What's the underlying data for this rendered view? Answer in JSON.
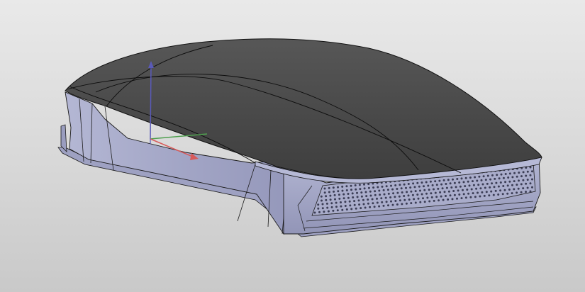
{
  "viewport": {
    "background_top": "#e9e9e9",
    "background_bottom": "#c9c9c9"
  },
  "model": {
    "top_shell_color": "#4b4b4b",
    "side_wall_color": "#a7aac9",
    "front_grille_color": "#a5a8c8",
    "edge_color": "#111111",
    "vent_hole_color": "#3b3d55"
  },
  "triad": {
    "z_axis_color": "#5a5ab8",
    "y_axis_color": "#4fa04f",
    "x_axis_color": "#d85a5a"
  }
}
